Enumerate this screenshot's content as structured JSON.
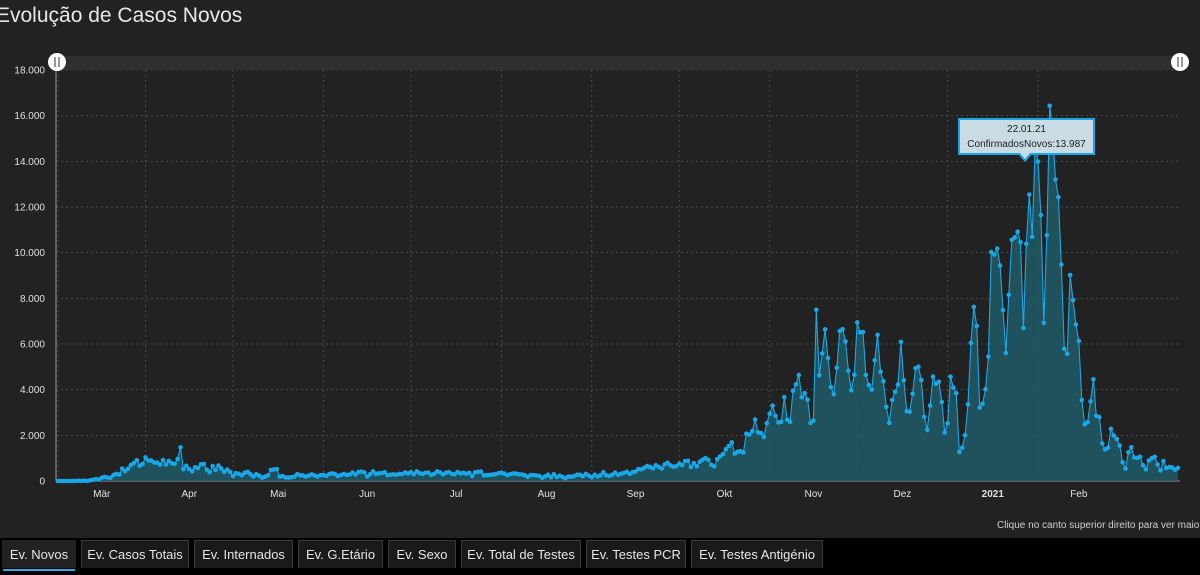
{
  "title": "Evolução de Casos Novos",
  "footnote": "Clique no canto superior direito para ver maior",
  "tooltip": {
    "date": "22.01.21",
    "series": "ConfirmadosNovos",
    "value": "13.987",
    "line1": "22.01.21",
    "line2": "ConfirmadosNovos:13.987"
  },
  "colors": {
    "background": "#222222",
    "line": "#1aa7e8",
    "area": "#1f5a66",
    "tooltip_border": "#1aa7e8",
    "grid": "#4a4a4a"
  },
  "tabs": [
    {
      "label": "Ev. Novos",
      "active": true
    },
    {
      "label": "Ev. Casos Totais",
      "active": false
    },
    {
      "label": "Ev. Internados",
      "active": false
    },
    {
      "label": "Ev. G.Etário",
      "active": false
    },
    {
      "label": "Ev. Sexo",
      "active": false
    },
    {
      "label": "Ev. Total de Testes",
      "active": false
    },
    {
      "label": "Ev. Testes PCR",
      "active": false
    },
    {
      "label": "Ev. Testes Antigénio",
      "active": false
    }
  ],
  "chart_data": {
    "type": "area",
    "title": "Evolução de Casos Novos",
    "xlabel": "",
    "ylabel": "",
    "ylim": [
      0,
      18000
    ],
    "y_ticks": [
      "0",
      "2.000",
      "4.000",
      "6.000",
      "8.000",
      "10.000",
      "12.000",
      "14.000",
      "16.000",
      "18.000"
    ],
    "x_ticks": [
      "Mär",
      "Apr",
      "Mai",
      "Jun",
      "Jul",
      "Aug",
      "Sep",
      "Okt",
      "Nov",
      "Dez",
      "2021",
      "Feb"
    ],
    "grid": true,
    "x_start": "2020-03-02",
    "series": [
      {
        "name": "ConfirmadosNovos",
        "values": [
          0,
          2,
          0,
          2,
          2,
          5,
          3,
          13,
          6,
          14,
          0,
          32,
          54,
          78,
          64,
          138,
          178,
          154,
          137,
          260,
          312,
          284,
          546,
          430,
          539,
          700,
          784,
          906,
          667,
          745,
          1035,
          900,
          892,
          808,
          802,
          718,
          921,
          723,
          881,
          780,
          750,
          963,
          1474,
          516,
          664,
          520,
          429,
          601,
          575,
          732,
          743,
          501,
          384,
          657,
          488,
          676,
          542,
          400,
          498,
          399,
          214,
          342,
          316,
          254,
          359,
          404,
          297,
          191,
          298,
          234,
          150,
          190,
          251,
          481,
          510,
          522,
          187,
          213,
          159,
          147,
          163,
          188,
          296,
          251,
          245,
          193,
          235,
          287,
          241,
          199,
          253,
          265,
          223,
          308,
          332,
          301,
          221,
          263,
          305,
          266,
          284,
          374,
          286,
          388,
          417,
          377,
          195,
          299,
          425,
          311,
          336,
          350,
          384,
          256,
          277,
          287,
          271,
          309,
          300,
          376,
          330,
          389,
          299,
          419,
          343,
          313,
          360,
          367,
          266,
          315,
          419,
          377,
          287,
          361,
          392,
          311,
          294,
          392,
          332,
          361,
          318,
          357,
          213,
          375,
          405,
          413,
          245,
          252,
          267,
          280,
          304,
          339,
          365,
          322,
          260,
          292,
          329,
          326,
          293,
          291,
          252,
          188,
          253,
          264,
          240,
          222,
          140,
          195,
          274,
          165,
          292,
          174,
          233,
          179,
          121,
          202,
          185,
          220,
          274,
          273,
          205,
          311,
          236,
          164,
          277,
          196,
          249,
          386,
          250,
          222,
          276,
          370,
          271,
          314,
          355,
          401,
          309,
          384,
          411,
          525,
          508,
          579,
          659,
          609,
          555,
          689,
          616,
          549,
          729,
          795,
          683,
          625,
          650,
          762,
          697,
          877,
          884,
          613,
          784,
          646,
          845,
          929,
          1005,
          923,
          709,
          638,
          952,
          1078,
          1178,
          1394,
          1533,
          1689,
          1200,
          1281,
          1304,
          1249,
          2072,
          2037,
          2182,
          2692,
          2133,
          2099,
          1931,
          2526,
          2943,
          3301,
          2853,
          2567,
          2591,
          3669,
          2691,
          2590,
          3951,
          4235,
          4639,
          3665,
          3853,
          3562,
          2541,
          2650,
          7497,
          4635,
          5582,
          6640,
          5389,
          4118,
          3802,
          4962,
          6571,
          6650,
          6112,
          4829,
          3978,
          4656,
          6946,
          6507,
          6524,
          4647,
          4198,
          4008,
          5288,
          6398,
          4789,
          4372,
          3247,
          2545,
          3545,
          3907,
          4228,
          6094,
          4409,
          3063,
          3032,
          3825,
          4936,
          5004,
          4422,
          2806,
          2240,
          3304,
          4574,
          4263,
          4346,
          3460,
          2125,
          2527,
          4566,
          4096,
          3841,
          1268,
          1462,
          2005,
          3363,
          6049,
          7627,
          6787,
          3215,
          3379,
          4019,
          5451,
          10027,
          9921,
          10176,
          9432,
          7489,
          5604,
          8155,
          10559,
          10663,
          10917,
          10456,
          6702,
          10385,
          12545,
          10698,
          14647,
          13987,
          11650,
          6923,
          10765,
          16432,
          15333,
          13200,
          12435,
          9478,
          5790,
          5565,
          9022,
          7924,
          6855,
          6131,
          3549,
          2482,
          2570,
          3488,
          4456,
          2850,
          2800,
          1648,
          1383,
          1454,
          2283,
          1991,
          1839,
          1555,
          817,
          548,
          1257,
          1480,
          1031,
          1013,
          1064,
          688,
          511,
          897,
          996,
          1059,
          723,
          465,
          873,
          569,
          609,
          591,
          495,
          573
        ]
      }
    ]
  }
}
